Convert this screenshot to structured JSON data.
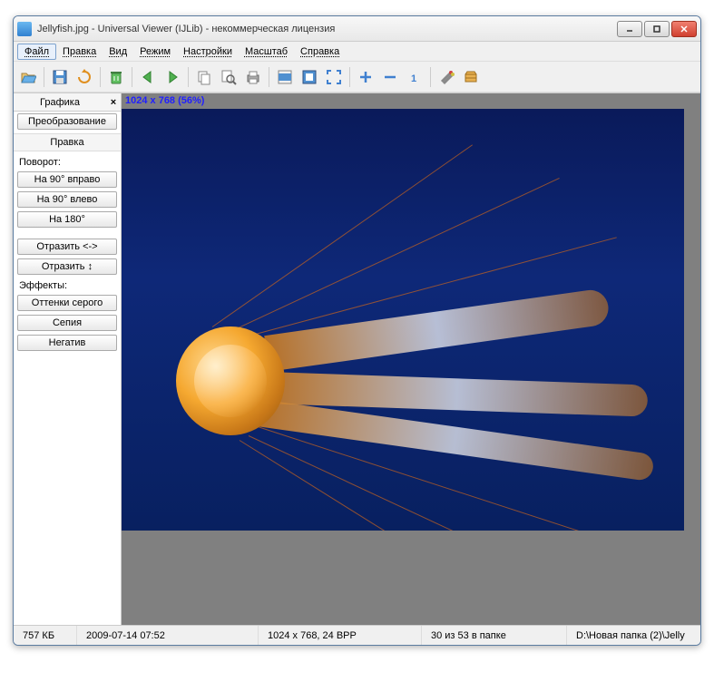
{
  "title": "Jellyfish.jpg - Universal Viewer (IJLib) - некоммерческая лицензия",
  "menu": {
    "file": "Файл",
    "edit": "Правка",
    "view": "Вид",
    "mode": "Режим",
    "settings": "Настройки",
    "zoom": "Масштаб",
    "help": "Справка"
  },
  "sidebar": {
    "tab": "Графика",
    "transform": "Преобразование",
    "edit_hdr": "Правка",
    "rotation_lbl": "Поворот:",
    "rot90r": "На 90° вправо",
    "rot90l": "На 90° влево",
    "rot180": "На 180°",
    "flip_h": "Отразить <->",
    "flip_v": "Отразить ↕",
    "effects_lbl": "Эффекты:",
    "grayscale": "Оттенки серого",
    "sepia": "Сепия",
    "negative": "Негатив"
  },
  "viewer": {
    "dimensions": "1024 x 768 (56%)"
  },
  "status": {
    "size": "757 КБ",
    "date": "2009-07-14 07:52",
    "dims": "1024 x 768, 24 BPP",
    "index": "30 из 53 в папке",
    "path": "D:\\Новая папка (2)\\Jelly"
  }
}
